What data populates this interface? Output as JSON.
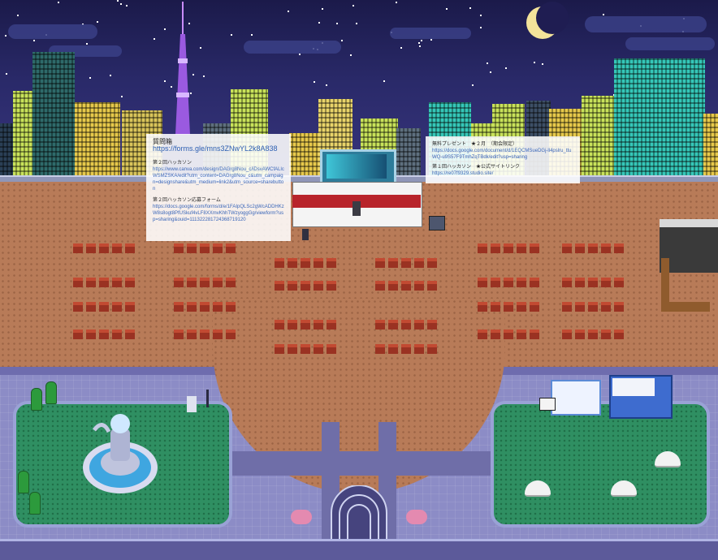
{
  "notes": {
    "left": {
      "title": "質問箱",
      "link": "https://forms.gle/mns3ZNwYL2k8A838",
      "section1_title": "第２回ハッカソン",
      "section1_link": "https://www.canva.com/design/DAGrg8Nou_c/iDsvAWCfALlcWSMZSKA/edit?utm_content=DAGrg8Nou_c&utm_campaign=designshare&utm_medium=link2&utm_source=sharebutton",
      "section2_title": "第２回ハッカソン応募フォーム",
      "section2_link": "https://docs.google.com/forms/d/e/1FAIpQLSc2gWcADDHKzW8s8ogt8PfUSkuf4vLF8XXmvKhhTWzyoggGg/viewform?usp=sharing&ouid=111322281724368719120"
    },
    "right": {
      "title": "無料プレゼント　★２月　（期会限定）",
      "link1": "https://docs.google.com/document/d/1EQCMSueDGj-ll4pslru_ttuWQ-u9S57F9TmhZqTBdk/edit?usp=sharing",
      "section_title": "第１回ハッカソン　★公式サイトリンク",
      "link2": "https://re07f9329.studio.site/"
    }
  },
  "icons": {
    "moon": "crescent-moon-icon",
    "tower": "tokyo-tower-icon",
    "fountain": "fountain-icon",
    "food_truck": "food-truck-icon",
    "podium": "podium-icon"
  },
  "colors": {
    "sky": "#1b1a4a",
    "plaza": "#b87b58",
    "sidewalk": "#8c8cc6",
    "grass": "#2f8f62",
    "stage_stripe": "#b8242b",
    "tower": "#9a5ae0"
  }
}
